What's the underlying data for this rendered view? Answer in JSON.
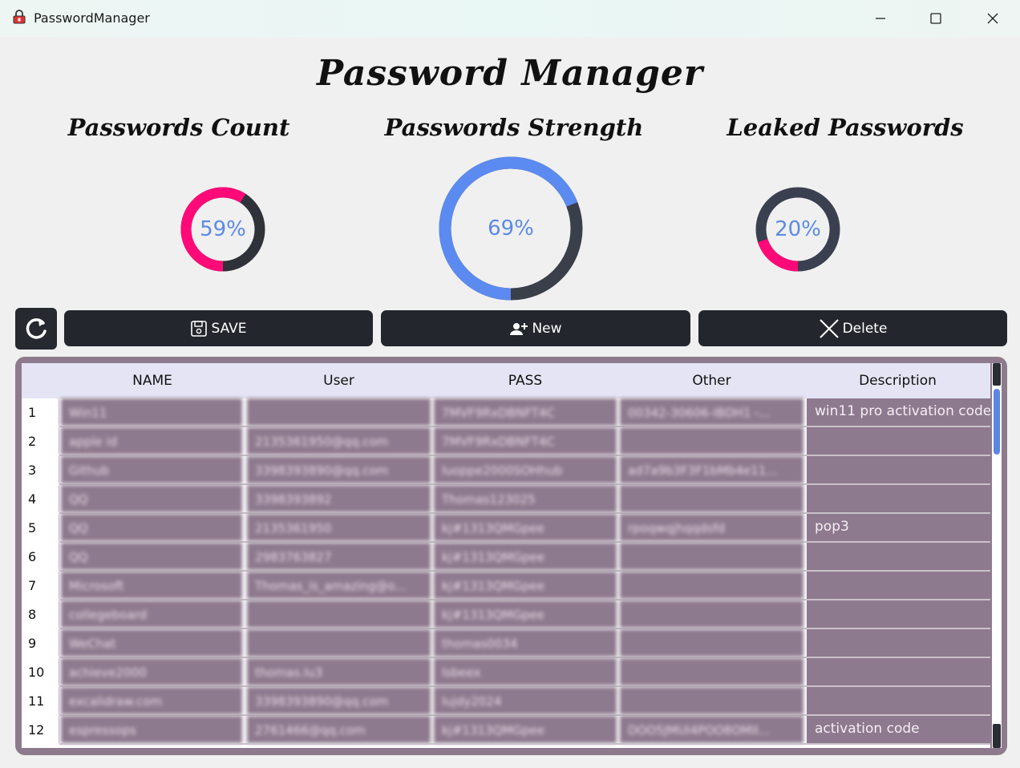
{
  "window": {
    "title": "PasswordManager"
  },
  "heading": "Password Manager",
  "gauges": [
    {
      "title": "Passwords Count",
      "value": 59,
      "label": "59%",
      "fill_color": "#ff0a78",
      "track_color": "#2f3339",
      "text_color": "#5b8ae6",
      "start": "bottom"
    },
    {
      "title": "Passwords Strength",
      "value": 69,
      "label": "69%",
      "fill_color": "#5b8af0",
      "track_color": "#3a3f4a",
      "text_color": "#5b8ae6",
      "start": "bottom"
    },
    {
      "title": "Leaked Passwords",
      "value": 20,
      "label": "20%",
      "fill_color": "#ff0a78",
      "track_color": "#3a4050",
      "text_color": "#5b8ae6",
      "start": "bottom"
    }
  ],
  "toolbar": {
    "refresh_icon": "refresh-icon",
    "save_label": "SAVE",
    "new_label": "New",
    "delete_label": "Delete"
  },
  "table": {
    "columns": [
      "NAME",
      "User",
      "PASS",
      "Other",
      "Description"
    ],
    "rows": [
      {
        "num": "1",
        "name": "Win11",
        "user": "",
        "pass": "7MVF9RxDBNFT4C",
        "other": "00342-30606-IBDH1 -...",
        "desc": "win11 pro activation code"
      },
      {
        "num": "2",
        "name": "apple id",
        "user": "2135361950@qq.com",
        "pass": "7MVF9RxDBNFT4C",
        "other": "",
        "desc": ""
      },
      {
        "num": "3",
        "name": "Github",
        "user": "3398393890@qq.com",
        "pass": "luoppe2000SOHhub",
        "other": "ad7a9b3F3F1bMb4e11...",
        "desc": ""
      },
      {
        "num": "4",
        "name": "QQ",
        "user": "3398393892",
        "pass": "Thomas123025",
        "other": "",
        "desc": ""
      },
      {
        "num": "5",
        "name": "QQ",
        "user": "2135361950",
        "pass": "kj#1313QMGpee",
        "other": "rpoqwqjhqqdsfd",
        "desc": "pop3"
      },
      {
        "num": "6",
        "name": "QQ",
        "user": "2983763827",
        "pass": "kj#1313QMGpee",
        "other": "",
        "desc": ""
      },
      {
        "num": "7",
        "name": "Microsoft",
        "user": "Thomas_is_amazing@o...",
        "pass": "kj#1313QMGpee",
        "other": "",
        "desc": ""
      },
      {
        "num": "8",
        "name": "collegeboard",
        "user": "",
        "pass": "kj#1313QMGpee",
        "other": "",
        "desc": ""
      },
      {
        "num": "9",
        "name": "WeChat",
        "user": "",
        "pass": "thomas0034",
        "other": "",
        "desc": ""
      },
      {
        "num": "10",
        "name": "achieve2000",
        "user": "thomas.lu3",
        "pass": "lsbeex",
        "other": "",
        "desc": ""
      },
      {
        "num": "11",
        "name": "excalidraw.com",
        "user": "3398393890@qq.com",
        "pass": "lujdy2024",
        "other": "",
        "desc": ""
      },
      {
        "num": "12",
        "name": "espressops",
        "user": "2761466@qq.com",
        "pass": "kj#1313QMGpee",
        "other": "DOO5JMUI4POO8OMII...",
        "desc": "activation code"
      }
    ]
  },
  "colors": {
    "background": "#f0f0f0",
    "button_bg": "#23272d",
    "table_frame": "#8d7b8d",
    "cell_bg": "#8e7a8e",
    "header_bg": "#e4e4f4",
    "scroll_thumb": "#5b86e3"
  }
}
